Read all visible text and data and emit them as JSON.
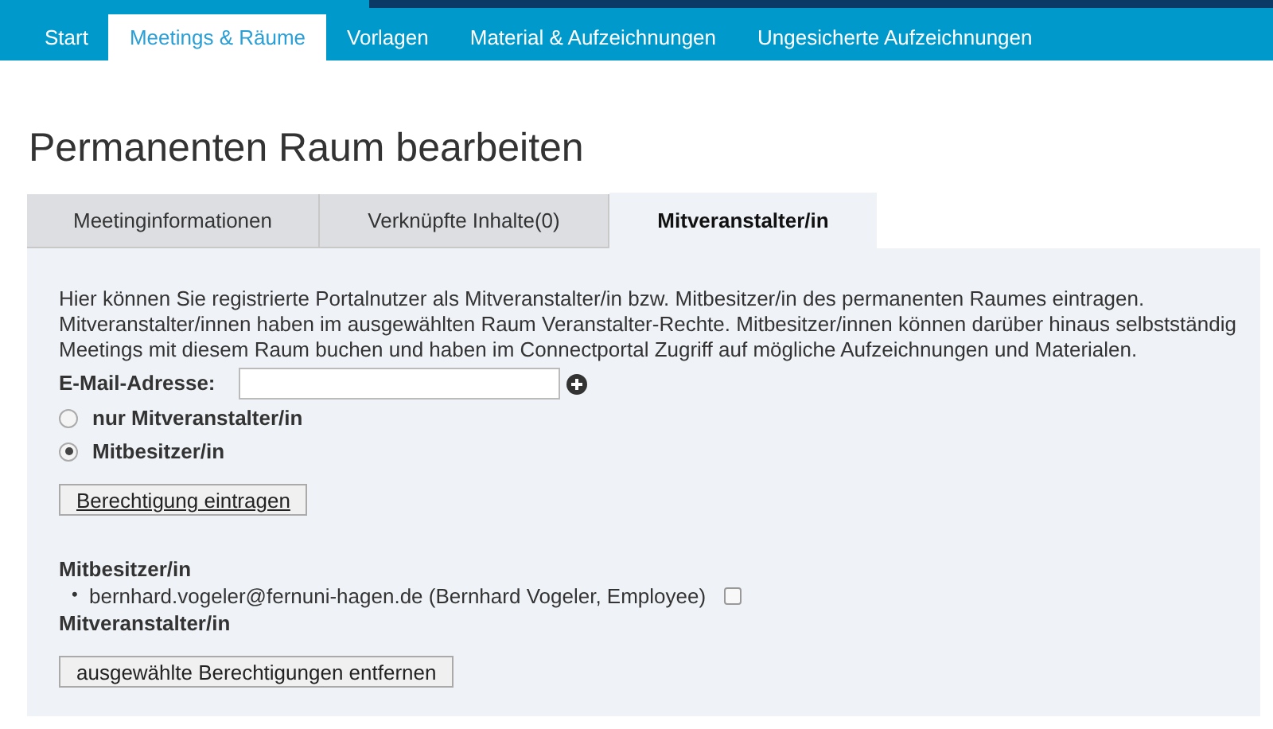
{
  "nav": [
    {
      "label": "Start",
      "selected": false
    },
    {
      "label": "Meetings & Räume",
      "selected": true
    },
    {
      "label": "Vorlagen",
      "selected": false
    },
    {
      "label": "Material & Aufzeichnungen",
      "selected": false
    },
    {
      "label": "Ungesicherte Aufzeichnungen",
      "selected": false
    }
  ],
  "heading": "Permanenten Raum bearbeiten",
  "tabs": [
    {
      "label": "Meetinginformationen",
      "selected": false
    },
    {
      "label": "Verknüpfte Inhalte(0)",
      "selected": false
    },
    {
      "label": "Mitveranstalter/in",
      "selected": true
    }
  ],
  "intro": "Hier können Sie registrierte Portalnutzer als Mitveranstalter/in bzw. Mitbesitzer/in des permanenten Raumes eintragen. Mitveranstalter/innen haben im ausgewählten Raum Veranstalter-Rechte. Mitbesitzer/innen können darüber hinaus selbstständig Meetings mit diesem Raum buchen und haben im Connectportal Zugriff auf mögliche Aufzeichnungen und Materialen.",
  "email_label": "E-Mail-Adresse:",
  "roles": [
    {
      "label": "nur Mitveranstalter/in",
      "selected": false
    },
    {
      "label": "Mitbesitzer/in",
      "selected": true
    }
  ],
  "add_button": "Berechtigung eintragen",
  "groups": [
    {
      "title": "Mitbesitzer/in",
      "members": [
        {
          "bullet": "•",
          "text": "bernhard.vogeler@fernuni-hagen.de (Bernhard Vogeler, Employee)",
          "checked": false
        }
      ]
    },
    {
      "title": "Mitveranstalter/in"
    }
  ],
  "remove_button": "ausgewählte Berechtigungen entfernen"
}
